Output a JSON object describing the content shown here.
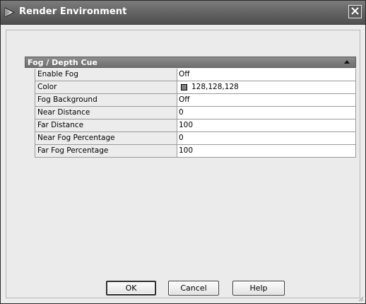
{
  "window": {
    "title": "Render Environment",
    "icon": "app-icon",
    "close_icon": "close-icon"
  },
  "section": {
    "title": "Fog / Depth Cue",
    "collapse_icon": "collapse-up-icon"
  },
  "properties": [
    {
      "label": "Enable Fog",
      "value": "Off"
    },
    {
      "label": "Color",
      "value": "128,128,128",
      "swatch": "#808080"
    },
    {
      "label": "Fog Background",
      "value": "Off"
    },
    {
      "label": "Near Distance",
      "value": "0"
    },
    {
      "label": "Far Distance",
      "value": "100"
    },
    {
      "label": "Near Fog Percentage",
      "value": "0"
    },
    {
      "label": "Far Fog Percentage",
      "value": "100"
    }
  ],
  "buttons": {
    "ok": "OK",
    "cancel": "Cancel",
    "help": "Help"
  }
}
